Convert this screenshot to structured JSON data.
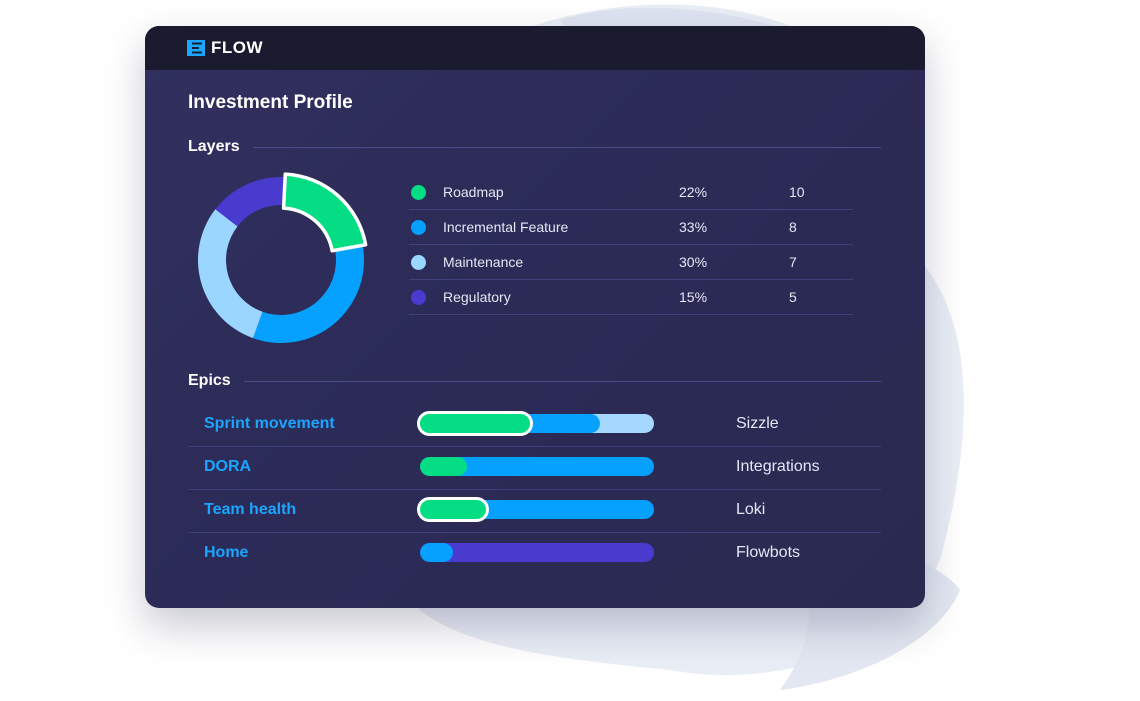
{
  "brand": {
    "name": "FLOW",
    "icon": "flow-logo-icon",
    "accent": "#1aa5ff"
  },
  "page": {
    "title": "Investment Profile"
  },
  "layers": {
    "heading": "Layers",
    "items": [
      {
        "label": "Roadmap",
        "percent": "22%",
        "count": "10",
        "color": "#04dd84",
        "share": 22,
        "highlighted": true
      },
      {
        "label": "Incremental Feature",
        "percent": "33%",
        "count": "8",
        "color": "#06a0ff",
        "share": 33,
        "highlighted": false
      },
      {
        "label": "Maintenance",
        "percent": "30%",
        "count": "7",
        "color": "#9ad6ff",
        "share": 30,
        "highlighted": false
      },
      {
        "label": "Regulatory",
        "percent": "15%",
        "count": "5",
        "color": "#4a3bcf",
        "share": 15,
        "highlighted": false
      }
    ]
  },
  "epics": {
    "heading": "Epics",
    "items": [
      {
        "name": "Sprint movement",
        "team": "Sizzle",
        "bar": {
          "green": 0.47,
          "blue": 0.77,
          "track_color": "#a5d8ff",
          "green_highlighted": true
        }
      },
      {
        "name": "DORA",
        "team": "Integrations",
        "bar": {
          "green": 0.2,
          "blue": 1.0,
          "track_color": "#06a0ff",
          "green_highlighted": false
        }
      },
      {
        "name": "Team health",
        "team": "Loki",
        "bar": {
          "green": 0.28,
          "blue": 1.0,
          "track_color": "#06a0ff",
          "green_highlighted": true
        }
      },
      {
        "name": "Home",
        "team": "Flowbots",
        "bar": {
          "green": 0,
          "blue": 0.14,
          "track_color": "#4a3bcf",
          "green_highlighted": false
        }
      }
    ]
  },
  "colors": {
    "green": "#04dd84",
    "blue": "#06a0ff",
    "light_blue": "#9ad6ff",
    "purple": "#4a3bcf",
    "card_bg": "#2d2c58",
    "topbar_bg": "#1b1b30"
  }
}
